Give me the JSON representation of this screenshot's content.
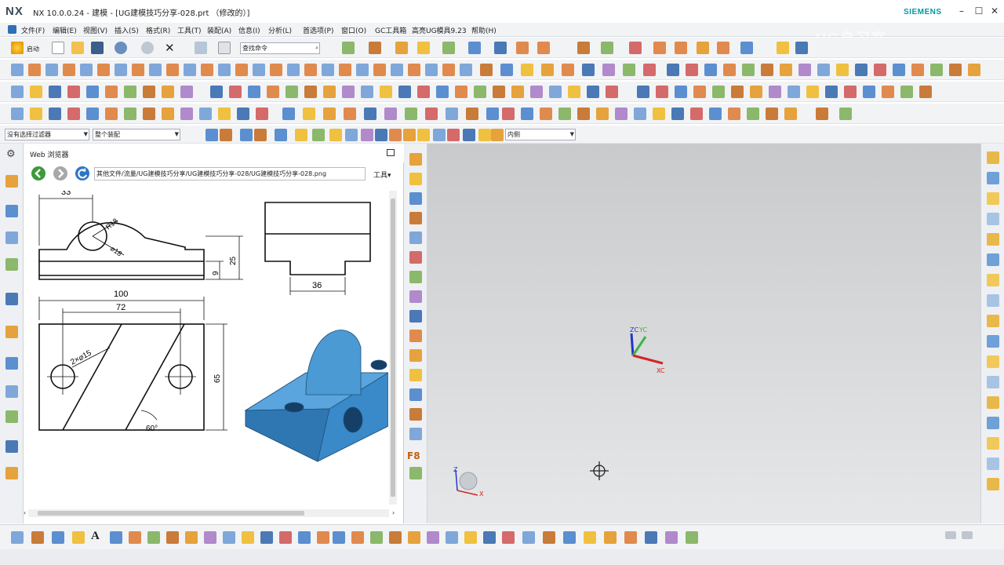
{
  "window": {
    "app_logo": "NX",
    "title": "NX 10.0.0.24 - 建模 - [UG建模技巧分享-028.prt （修改的）]",
    "brand": "SIEMENS",
    "watermark": "UG自习室"
  },
  "menubar": {
    "items": [
      "文件(F)",
      "编辑(E)",
      "视图(V)",
      "插入(S)",
      "格式(R)",
      "工具(T)",
      "装配(A)",
      "信息(I)",
      "分析(L)",
      "首选项(P)",
      "窗口(O)",
      "GC工具箱",
      "高亮UG模具9.23",
      "帮助(H)"
    ]
  },
  "toolbar": {
    "start_label": "启动",
    "search_placeholder": "查找命令",
    "selection_filter": "没有选择过滤器",
    "assembly_scope": "整个装配",
    "snap_option": "内侧"
  },
  "web_browser": {
    "title": "Web 浏览器",
    "url": "其他文件/流量/UG建模技巧分享/UG建模技巧分享-028/UG建模技巧分享-028.png",
    "tools_label": "工具"
  },
  "drawing": {
    "dim_33": "33",
    "dim_r18": "R18",
    "dim_d18": "⌀18",
    "dim_25": "25",
    "dim_9": "9",
    "dim_36": "36",
    "dim_100": "100",
    "dim_72": "72",
    "dim_holes": "2×⌀15",
    "dim_65": "65",
    "dim_60": "60°"
  },
  "graphics": {
    "axis_z": "ZC",
    "axis_y": "YC",
    "axis_x": "XC",
    "mini_z": "Z",
    "mini_x": "X"
  },
  "sidebar_labels": {
    "f8": "F8"
  },
  "colors": {
    "model_blue": "#3a89c9",
    "siemens_teal": "#009aa6",
    "graphics_bg": "#d6d8da"
  },
  "statusbar": {
    "text": ""
  }
}
